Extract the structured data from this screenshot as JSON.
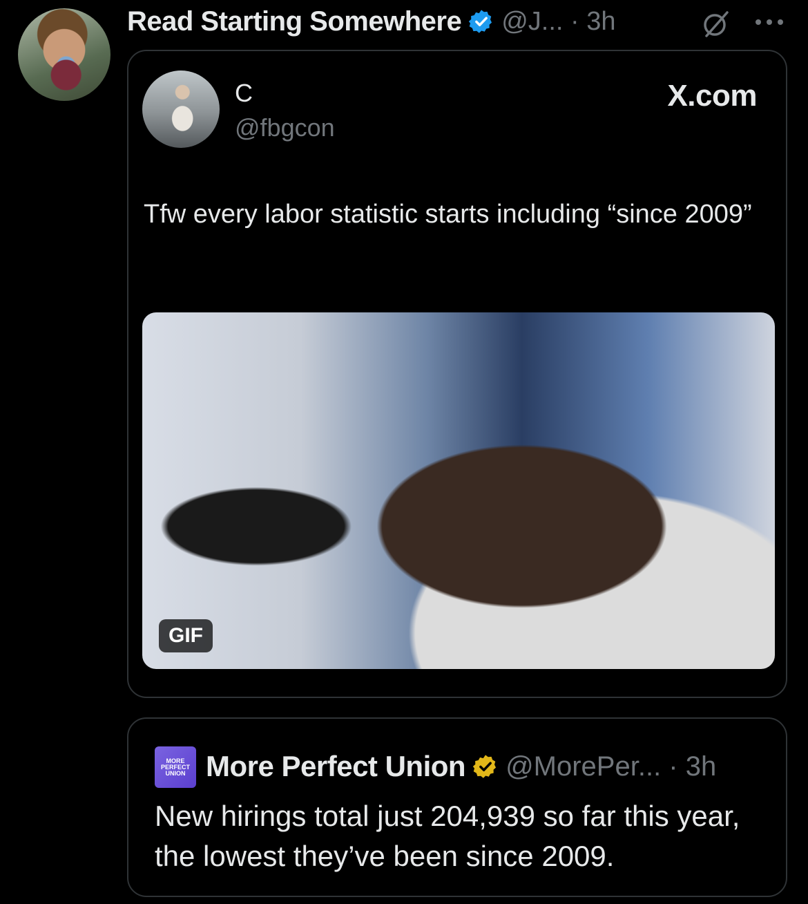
{
  "tweet": {
    "display_name": "Read Starting Somewhere",
    "handle_time": "@J... · 3h"
  },
  "embed": {
    "author_name": "C",
    "author_handle": "@fbgcon",
    "source": "X.com",
    "text": "Tfw every labor statistic starts including “since 2009”",
    "gif_label": "GIF"
  },
  "quoted": {
    "logo_text": [
      "MORE",
      "PERFECT",
      "UNION"
    ],
    "display_name": "More Perfect Union",
    "handle_time": "@MorePer... · 3h",
    "text": "New hirings total just 204,939 so far this year, the lowest they’ve been since 2009."
  },
  "colors": {
    "background": "#000000",
    "text": "#e7e9ea",
    "muted": "#71767b",
    "border": "#2f3336",
    "verified_blue": "#1d9bf0",
    "verified_gold": "#e2b719"
  }
}
